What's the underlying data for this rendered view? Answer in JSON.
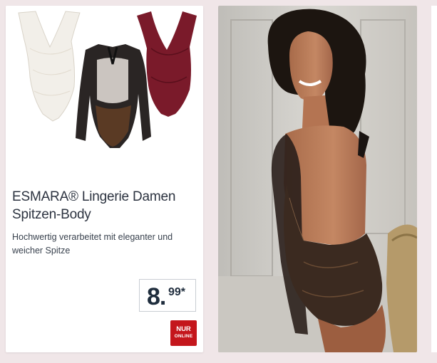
{
  "product": {
    "title_line1": "ESMARA® Lingerie Damen",
    "title_line2": "Spitzen-Body",
    "description": "Hochwertig verarbeitet mit eleganter und weicher Spitze",
    "price_main": "8.",
    "price_cents": "99*",
    "badge_line1": "NUR",
    "badge_line2": "ONLINE"
  },
  "colors": {
    "badge": "#c4161c",
    "background": "#f0e6e8",
    "text": "#2c3340"
  }
}
